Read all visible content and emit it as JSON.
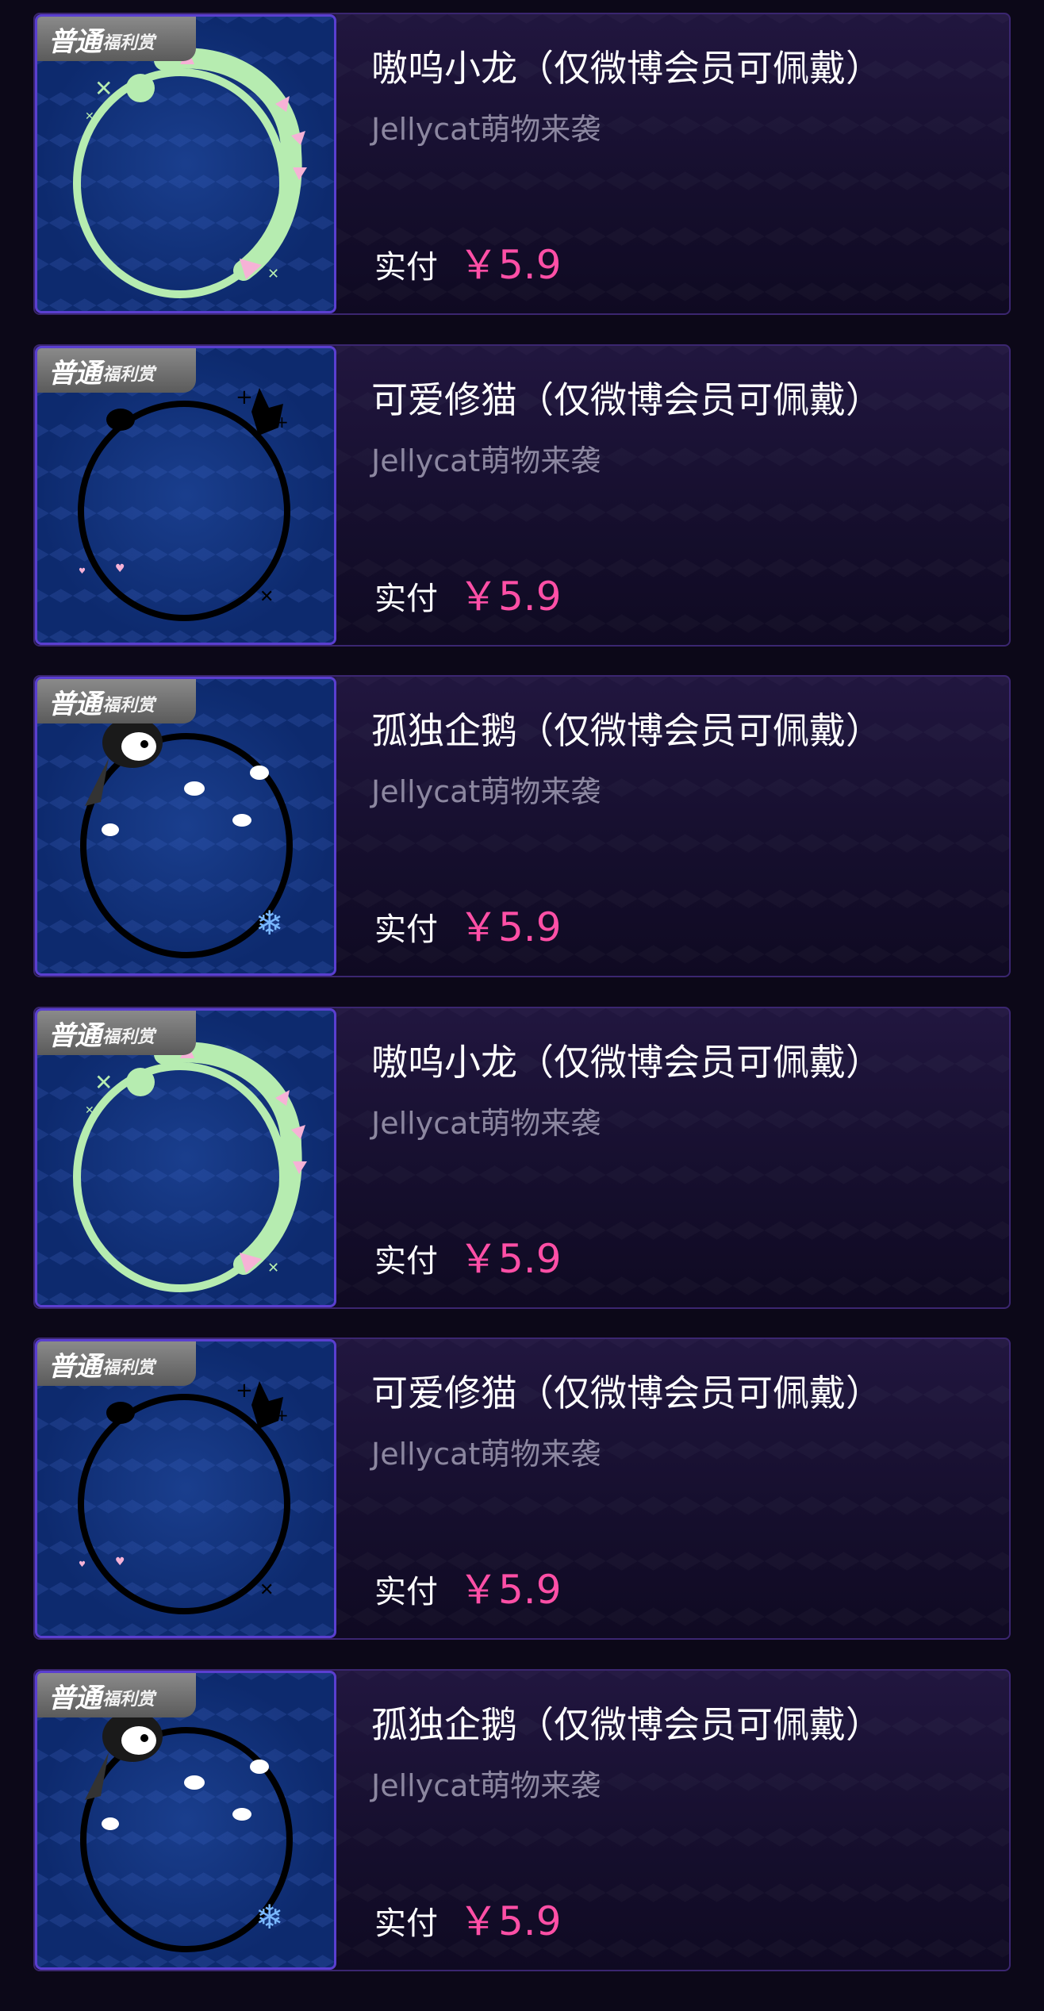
{
  "items": [
    {
      "badge_main": "普通",
      "badge_sub": "福利赏",
      "title": "嗷呜小龙（仅微博会员可佩戴）",
      "subtitle": "Jellycat萌物来袭",
      "pay_label": "实付",
      "price": "￥5.9",
      "frame_icon": "dragon-frame"
    },
    {
      "badge_main": "普通",
      "badge_sub": "福利赏",
      "title": "可爱修猫（仅微博会员可佩戴）",
      "subtitle": "Jellycat萌物来袭",
      "pay_label": "实付",
      "price": "￥5.9",
      "frame_icon": "cat-frame"
    },
    {
      "badge_main": "普通",
      "badge_sub": "福利赏",
      "title": "孤独企鹅（仅微博会员可佩戴）",
      "subtitle": "Jellycat萌物来袭",
      "pay_label": "实付",
      "price": "￥5.9",
      "frame_icon": "penguin-frame"
    },
    {
      "badge_main": "普通",
      "badge_sub": "福利赏",
      "title": "嗷呜小龙（仅微博会员可佩戴）",
      "subtitle": "Jellycat萌物来袭",
      "pay_label": "实付",
      "price": "￥5.9",
      "frame_icon": "dragon-frame"
    },
    {
      "badge_main": "普通",
      "badge_sub": "福利赏",
      "title": "可爱修猫（仅微博会员可佩戴）",
      "subtitle": "Jellycat萌物来袭",
      "pay_label": "实付",
      "price": "￥5.9",
      "frame_icon": "cat-frame"
    },
    {
      "badge_main": "普通",
      "badge_sub": "福利赏",
      "title": "孤独企鹅（仅微博会员可佩戴）",
      "subtitle": "Jellycat萌物来袭",
      "pay_label": "实付",
      "price": "￥5.9",
      "frame_icon": "penguin-frame"
    }
  ],
  "colors": {
    "price": "#ff4fa6",
    "dragon": "#b6ecb0",
    "dragon_spikes": "#f6b2d6",
    "cat_penguin_outline": "#000000",
    "snowflake": "#7ab8ff"
  }
}
